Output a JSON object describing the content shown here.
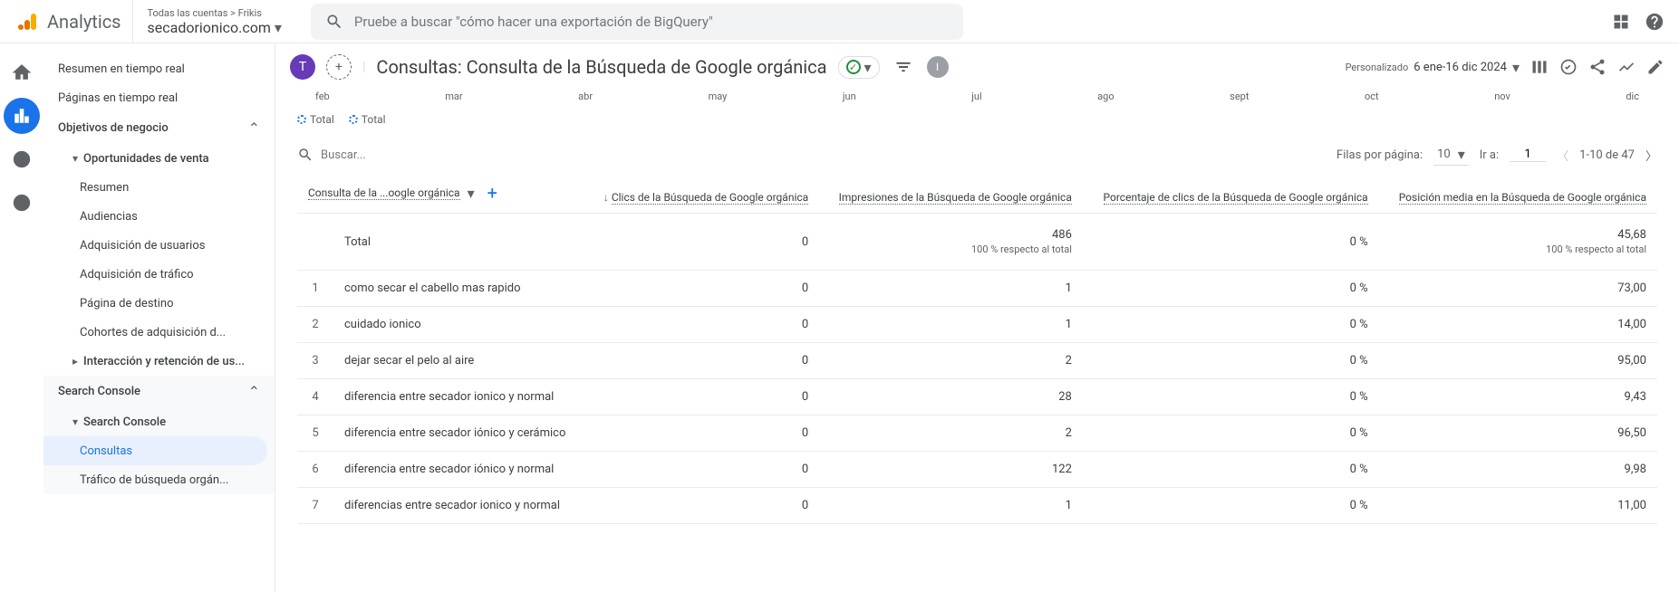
{
  "header": {
    "product": "Analytics",
    "breadcrumb": "Todas las cuentas > Frikis",
    "property": "secadorionico.com",
    "search_placeholder": "Pruebe a buscar \"cómo hacer una exportación de BigQuery\""
  },
  "sidebar": {
    "realtime_summary": "Resumen en tiempo real",
    "realtime_pages": "Páginas en tiempo real",
    "business_objectives": "Objetivos de negocio",
    "sales_opportunities": "Oportunidades de venta",
    "items": {
      "resumen": "Resumen",
      "audiencias": "Audiencias",
      "adq_usuarios": "Adquisición de usuarios",
      "adq_trafico": "Adquisición de tráfico",
      "pagina_destino": "Página de destino",
      "cohortes": "Cohortes de adquisición d...",
      "interaccion": "Interacción y retención de us..."
    },
    "search_console_group": "Search Console",
    "search_console": "Search Console",
    "consultas": "Consultas",
    "trafico_organico": "Tráfico de búsqueda orgán..."
  },
  "page": {
    "tab_letter": "T",
    "title": "Consultas: Consulta de la Búsqueda de Google orgánica",
    "avatar_letter": "I",
    "date_label": "Personalizado",
    "date_range": "6 ene-16 dic 2024"
  },
  "chart": {
    "months": [
      "feb",
      "mar",
      "abr",
      "may",
      "jun",
      "jul",
      "ago",
      "sept",
      "oct",
      "nov",
      "dic"
    ],
    "legend1": "Total",
    "legend2": "Total"
  },
  "table": {
    "search_placeholder": "Buscar...",
    "rows_per_page_label": "Filas por página:",
    "rows_per_page": "10",
    "goto_label": "Ir a:",
    "goto_value": "1",
    "range": "1-10 de 47",
    "dim_header": "Consulta de la ...oogle orgánica",
    "headers": {
      "clicks": "Clics de la Búsqueda de Google orgánica",
      "impressions": "Impresiones de la Búsqueda de Google orgánica",
      "ctr": "Porcentaje de clics de la Búsqueda de Google orgánica",
      "position": "Posición media en la Búsqueda de Google orgánica"
    },
    "total_label": "Total",
    "totals": {
      "clicks": "0",
      "impressions": "486",
      "impressions_sub": "100 % respecto al total",
      "ctr": "0 %",
      "position": "45,68",
      "position_sub": "100 % respecto al total"
    },
    "rows": [
      {
        "idx": "1",
        "query": "como secar el cabello mas rapido",
        "clicks": "0",
        "impressions": "1",
        "ctr": "0 %",
        "position": "73,00"
      },
      {
        "idx": "2",
        "query": "cuidado ionico",
        "clicks": "0",
        "impressions": "1",
        "ctr": "0 %",
        "position": "14,00"
      },
      {
        "idx": "3",
        "query": "dejar secar el pelo al aire",
        "clicks": "0",
        "impressions": "2",
        "ctr": "0 %",
        "position": "95,00"
      },
      {
        "idx": "4",
        "query": "diferencia entre secador ionico y normal",
        "clicks": "0",
        "impressions": "28",
        "ctr": "0 %",
        "position": "9,43"
      },
      {
        "idx": "5",
        "query": "diferencia entre secador iónico y cerámico",
        "clicks": "0",
        "impressions": "2",
        "ctr": "0 %",
        "position": "96,50"
      },
      {
        "idx": "6",
        "query": "diferencia entre secador iónico y normal",
        "clicks": "0",
        "impressions": "122",
        "ctr": "0 %",
        "position": "9,98"
      },
      {
        "idx": "7",
        "query": "diferencias entre secador ionico y normal",
        "clicks": "0",
        "impressions": "1",
        "ctr": "0 %",
        "position": "11,00"
      }
    ]
  }
}
